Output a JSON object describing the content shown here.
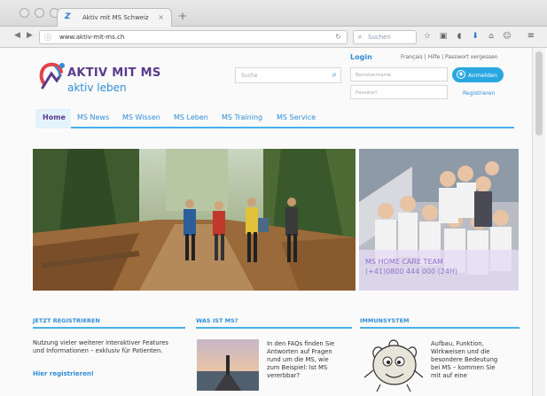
{
  "browser": {
    "tab_title": "Aktiv mit MS Schweiz",
    "tab_icon": "browser-favicon-icon",
    "url": "www.aktiv-mit-ms.ch",
    "search_placeholder": "Suchen"
  },
  "site": {
    "logo": {
      "line1": "AKTIV MIT MS",
      "line2": "aktiv leben"
    },
    "search_placeholder": "Suche",
    "login": {
      "title": "Login",
      "links": "Français | Hilfe | Passwort vergessen",
      "username_placeholder": "Benutzername",
      "password_placeholder": "Passwort",
      "login_button": "Anmelden",
      "register": "Registrieren"
    },
    "nav": [
      "Home",
      "MS News",
      "MS Wissen",
      "MS Leben",
      "MS Training",
      "MS Service"
    ],
    "ribbon": {
      "line1": "MS HOME CARE TEAM",
      "line2": "(+41)0800 444 000 (24H)"
    },
    "sections": {
      "register": {
        "heading": "JETZT REGISTRIEREN",
        "text1": "Nutzung vieler weiterer interaktiver Features",
        "text2": "und Informationen – exklusiv für Patienten.",
        "link": "Hier registrieren!"
      },
      "whatis": {
        "heading": "WAS IST MS?",
        "lines": [
          "In den FAQs finden Sie",
          "Antworten auf Fragen",
          "rund um die MS, wie",
          "zum Beispiel: Ist MS",
          "vererbbar?"
        ]
      },
      "immun": {
        "heading": "IMMUNSYSTEM",
        "lines": [
          "Aufbau, Funktion,",
          "Wirkweisen und die",
          "besondere Bedeutung",
          "bei MS – kommen Sie",
          "mit auf eine"
        ]
      }
    }
  },
  "colors": {
    "accent": "#2f8dd6",
    "brand": "#5a3b8c",
    "nav_line": "#48b0ea",
    "button": "#2aa7e0"
  }
}
